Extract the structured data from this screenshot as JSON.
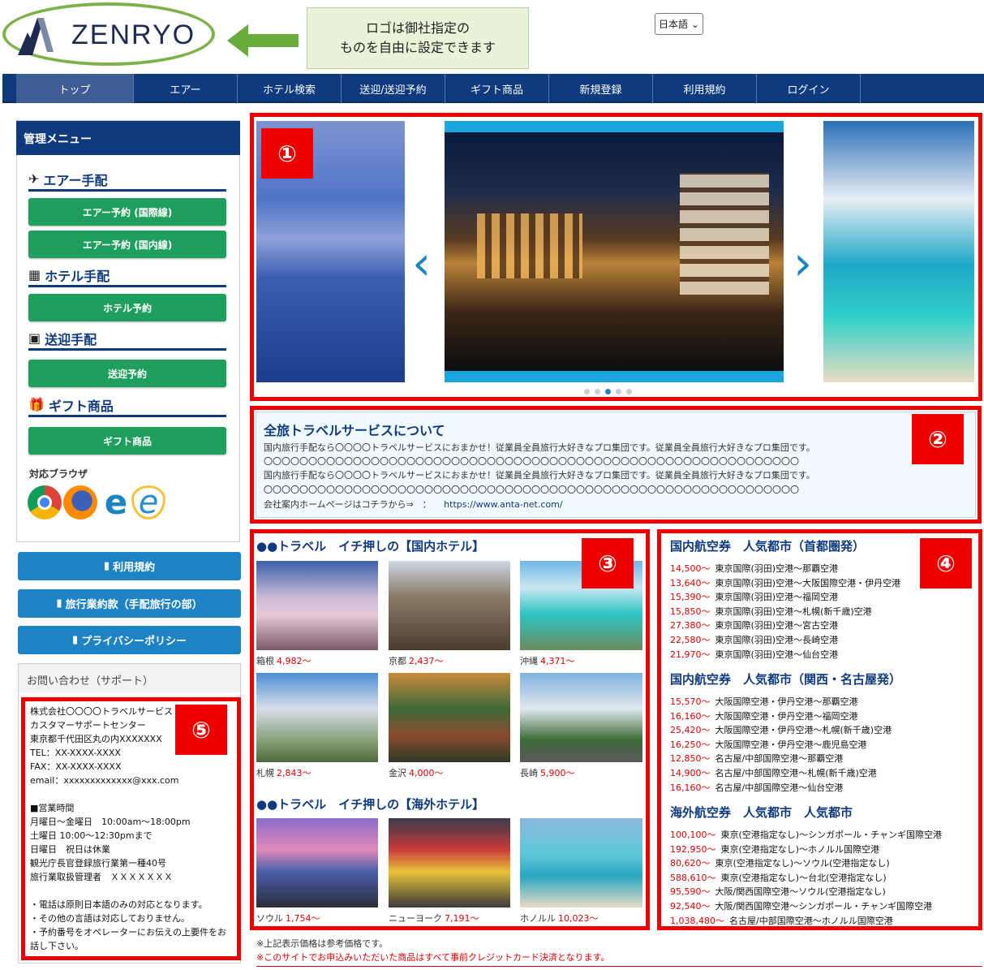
{
  "header": {
    "logo_text": "ZENRYO",
    "callout_line1": "ロゴは御社指定の",
    "callout_line2": "ものを自由に設定できます",
    "language": "日本語"
  },
  "nav": [
    "トップ",
    "エアー",
    "ホテル検索",
    "送迎/送迎予約",
    "ギフト商品",
    "新規登録",
    "利用規約",
    "ログイン"
  ],
  "sidebar": {
    "title": "管理メニュー",
    "sections": [
      {
        "label": "エアー手配",
        "icon": "airplane-icon",
        "buttons": [
          "エアー予約 (国際線)",
          "エアー予約 (国内線)"
        ]
      },
      {
        "label": "ホテル手配",
        "icon": "hotel-icon",
        "buttons": [
          "ホテル予約"
        ]
      },
      {
        "label": "送迎手配",
        "icon": "bus-icon",
        "buttons": [
          "送迎予約"
        ]
      },
      {
        "label": "ギフト商品",
        "icon": "gift-icon",
        "buttons": [
          "ギフト商品"
        ]
      }
    ],
    "browser_label": "対応ブラウザ",
    "links": [
      "利用規約",
      "旅行業約款（手配旅行の部）",
      "プライバシーポリシー"
    ]
  },
  "contact": {
    "title": "お問い合わせ（サポート）",
    "lines": [
      "株式会社〇〇〇〇トラベルサービス",
      "カスタマーサポートセンター",
      "東京都千代田区丸の内XXXXXXX",
      "TEL：XX-XXXX-XXXX",
      "FAX：XX-XXXX-XXXX",
      "email：xxxxxxxxxxxxx@xxx.com",
      "",
      "■営業時間",
      "月曜日～金曜日　10:00am～18:00pm",
      "土曜日 10:00～12:30pmまで",
      "日曜日　祝日は休業",
      "観光庁長官登録旅行業第一種40号",
      "旅行業取扱管理者　ＸＸＸＸＸＸＸ",
      "",
      "・電話は原則日本語のみの対応となります。",
      "・その他の言語は対応しておりません。",
      "・予約番号をオペレーターにお伝えの上要件をお",
      "話し下さい。"
    ]
  },
  "badges": [
    "①",
    "②",
    "③",
    "④",
    "⑤"
  ],
  "slider": {
    "dots": 5,
    "active": 2
  },
  "about": {
    "title": "全旅トラベルサービスについて",
    "line1": "国内旅行手配なら〇〇〇〇トラベルサービスにおまかせ！従業員全員旅行大好きなプロ集団です。従業員全員旅行大好きなプロ集団です。",
    "line2": "〇〇〇〇〇〇〇〇〇〇〇〇〇〇〇〇〇〇〇〇〇〇〇〇〇〇〇〇〇〇〇〇〇〇〇〇〇〇〇〇〇〇〇〇〇〇〇〇〇〇〇〇〇〇〇〇〇〇〇〇",
    "line3": "国内旅行手配なら〇〇〇〇トラベルサービスにおまかせ！従業員全員旅行大好きなプロ集団です。従業員全員旅行大好きなプロ集団です。",
    "line4": "〇〇〇〇〇〇〇〇〇〇〇〇〇〇〇〇〇〇〇〇〇〇〇〇〇〇〇〇〇〇〇〇〇〇〇〇〇〇〇〇〇〇〇〇〇〇〇〇〇〇〇〇〇〇〇〇〇〇〇〇",
    "link_label": "会社案内ホームページはコチラから⇒　：",
    "link_url": "https://www.anta-net.com/"
  },
  "hotels": {
    "domestic_title": "●●トラベル　イチ押しの【国内ホテル】",
    "overseas_title": "●●トラベル　イチ押しの【海外ホテル】",
    "domestic": [
      {
        "name": "箱根",
        "price": "4,982～"
      },
      {
        "name": "京都",
        "price": "2,437～"
      },
      {
        "name": "沖縄",
        "price": "4,371～"
      },
      {
        "name": "札幌",
        "price": "2,843～"
      },
      {
        "name": "金沢",
        "price": "4,000～"
      },
      {
        "name": "長崎",
        "price": "5,900～"
      }
    ],
    "overseas": [
      {
        "name": "ソウル",
        "price": "1,754～"
      },
      {
        "name": "ニューヨーク",
        "price": "7,191～"
      },
      {
        "name": "ホノルル",
        "price": "10,023～"
      }
    ]
  },
  "flights": [
    {
      "title": "国内航空券　人気都市（首都圏発）",
      "rows": [
        [
          "14,500～",
          "東京国際(羽田)空港～那覇空港"
        ],
        [
          "13,640～",
          "東京国際(羽田)空港～大阪国際空港・伊丹空港"
        ],
        [
          "15,390～",
          "東京国際(羽田)空港～福岡空港"
        ],
        [
          "15,850～",
          "東京国際(羽田)空港～札幌(新千歳)空港"
        ],
        [
          "27,380～",
          "東京国際(羽田)空港～宮古空港"
        ],
        [
          "22,580～",
          "東京国際(羽田)空港～長崎空港"
        ],
        [
          "21,970～",
          "東京国際(羽田)空港～仙台空港"
        ]
      ]
    },
    {
      "title": "国内航空券　人気都市（関西・名古屋発）",
      "rows": [
        [
          "15,570～",
          "大阪国際空港・伊丹空港～那覇空港"
        ],
        [
          "16,160～",
          "大阪国際空港・伊丹空港～福岡空港"
        ],
        [
          "25,420～",
          "大阪国際空港・伊丹空港～札幌(新千歳)空港"
        ],
        [
          "16,250～",
          "大阪国際空港・伊丹空港～鹿児島空港"
        ],
        [
          "12,850～",
          "名古屋/中部国際空港～那覇空港"
        ],
        [
          "14,900～",
          "名古屋/中部国際空港～札幌(新千歳)空港"
        ],
        [
          "16,160～",
          "名古屋/中部国際空港～仙台空港"
        ]
      ]
    },
    {
      "title": "海外航空券　人気都市　人気都市",
      "rows": [
        [
          "100,100～",
          "東京(空港指定なし)～シンガポール・チャンギ国際空港"
        ],
        [
          "192,950～",
          "東京(空港指定なし)～ホノルル国際空港"
        ],
        [
          "80,620～",
          "東京(空港指定なし)～ソウル(空港指定なし)"
        ],
        [
          "588,610～",
          "東京(空港指定なし)～台北(空港指定なし)"
        ],
        [
          "95,590～",
          "大阪/関西国際空港～ソウル(空港指定なし)"
        ],
        [
          "92,540～",
          "大阪/関西国際空港～シンガポール・チャンギ国際空港"
        ],
        [
          "1,038,480～",
          "名古屋/中部国際空港～ホノルル国際空港"
        ]
      ]
    }
  ],
  "notes": {
    "note1": "※上記表示価格は参考価格です。",
    "note2": "※このサイトでお申込みいただいた商品はすべて事前クレジットカード決済となります。"
  },
  "colors": {
    "navy": "#0f3a7e",
    "green": "#1e9f5e",
    "blue": "#1d83c5",
    "red": "#e00000"
  }
}
